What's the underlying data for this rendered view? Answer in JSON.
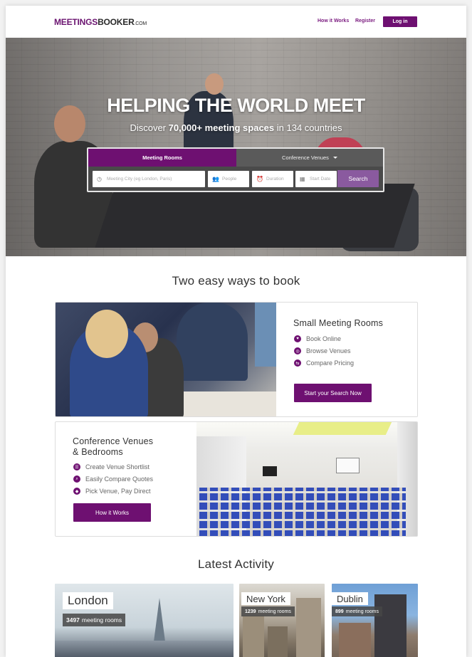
{
  "header": {
    "logo_part1": "MEETINGS",
    "logo_part2": "BOOKER",
    "logo_suffix": ".COM",
    "nav_how_it_works": "How it Works",
    "nav_register": "Register",
    "nav_login": "Log in"
  },
  "hero": {
    "title": "HELPING THE WORLD MEET",
    "subtitle_prefix": "Discover ",
    "subtitle_bold": "70,000+ meeting spaces",
    "subtitle_suffix": " in 134 countries"
  },
  "search": {
    "tab_meeting_rooms": "Meeting Rooms",
    "tab_conference_venues": "Conference Venues",
    "city_placeholder": "Meeting City (eg London, Paris)",
    "people_placeholder": "People",
    "duration_placeholder": "Duration",
    "start_date_placeholder": "Start Date",
    "search_label": "Search"
  },
  "section_book": {
    "title": "Two easy ways to book"
  },
  "small_rooms": {
    "title": "Small Meeting Rooms",
    "features": [
      "Book Online",
      "Browse Venues",
      "Compare Pricing"
    ],
    "button": "Start your Search Now"
  },
  "conference": {
    "title_line1": "Conference Venues",
    "title_line2": "& Bedrooms",
    "features": [
      "Create Venue Shortlist",
      "Easily Compare Quotes",
      "Pick Venue, Pay Direct"
    ],
    "button": "How it Works"
  },
  "section_activity": {
    "title": "Latest Activity"
  },
  "cities": [
    {
      "name": "London",
      "count": "3497",
      "suffix": "meeting rooms"
    },
    {
      "name": "New York",
      "count": "1239",
      "suffix": "meeting rooms"
    },
    {
      "name": "Dublin",
      "count": "899",
      "suffix": "meeting rooms"
    }
  ],
  "colors": {
    "brand_purple": "#6e1071",
    "search_button": "#8a5a9f"
  }
}
